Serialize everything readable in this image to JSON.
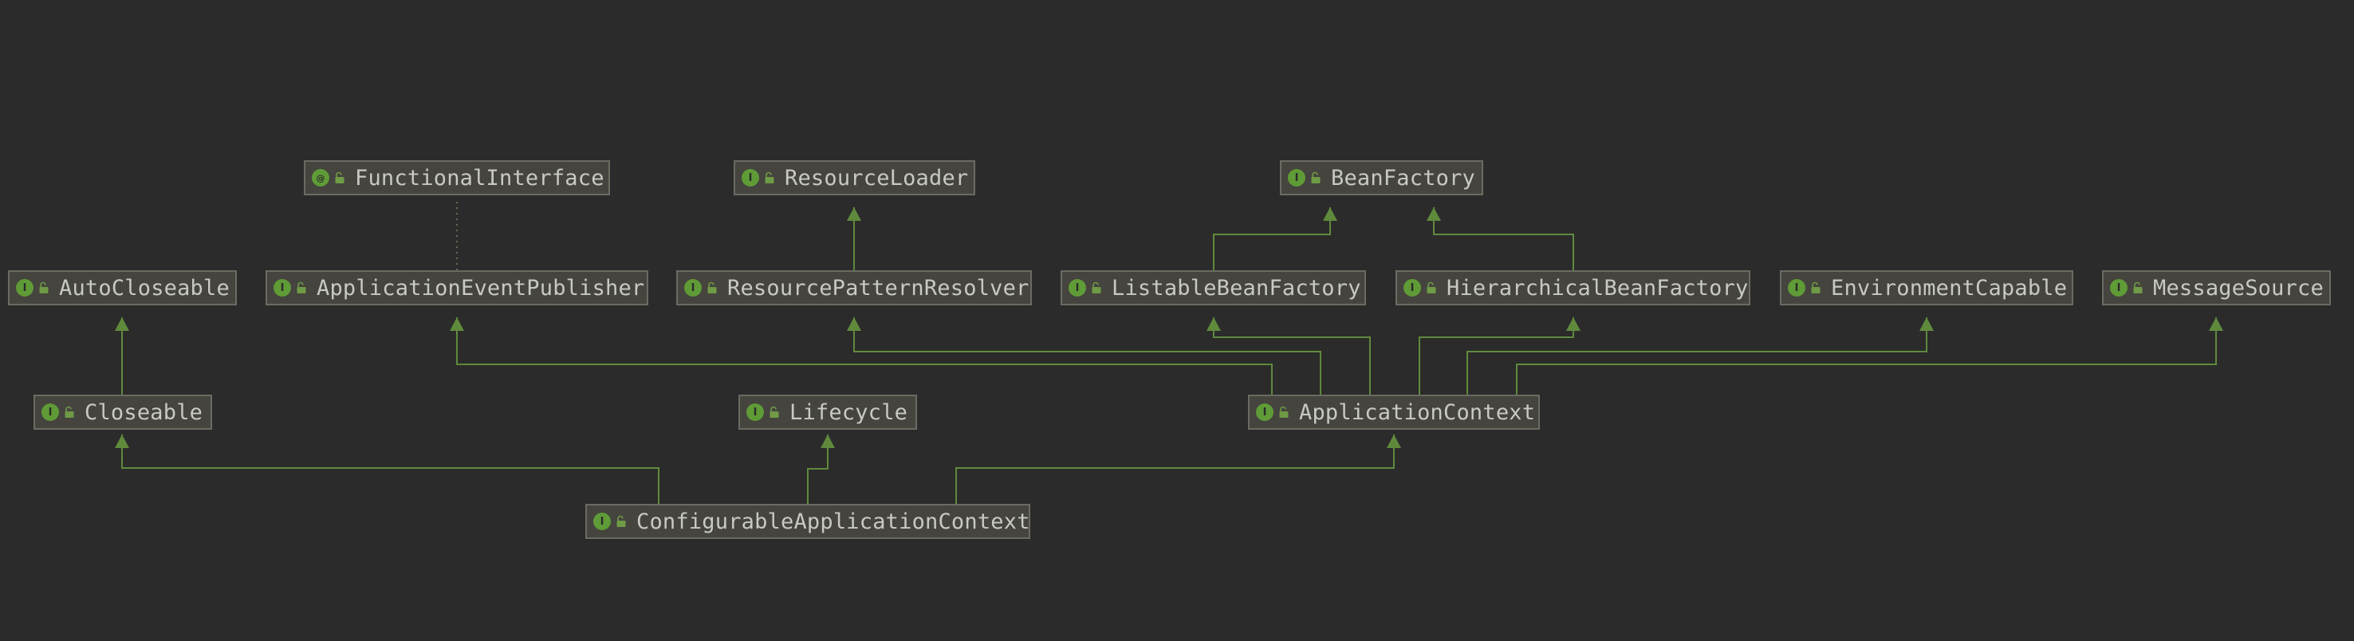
{
  "colors": {
    "background": "#2b2b2b",
    "node_fill": "#45443e",
    "node_border": "#6b6b62",
    "edge": "#5f8a3c",
    "badge": "#5f9b36",
    "text": "#c9c9c4"
  },
  "nodes": [
    {
      "id": "FunctionalInterface",
      "label": "FunctionalInterface",
      "kind": "annotation",
      "badge": "@",
      "visibility_icon": "unlocked-icon"
    },
    {
      "id": "ResourceLoader",
      "label": "ResourceLoader",
      "kind": "interface",
      "badge": "I",
      "visibility_icon": "unlocked-icon"
    },
    {
      "id": "BeanFactory",
      "label": "BeanFactory",
      "kind": "interface",
      "badge": "I",
      "visibility_icon": "unlocked-icon"
    },
    {
      "id": "AutoCloseable",
      "label": "AutoCloseable",
      "kind": "interface",
      "badge": "I",
      "visibility_icon": "unlocked-icon"
    },
    {
      "id": "ApplicationEventPublisher",
      "label": "ApplicationEventPublisher",
      "kind": "interface",
      "badge": "I",
      "visibility_icon": "unlocked-icon"
    },
    {
      "id": "ResourcePatternResolver",
      "label": "ResourcePatternResolver",
      "kind": "interface",
      "badge": "I",
      "visibility_icon": "unlocked-icon"
    },
    {
      "id": "ListableBeanFactory",
      "label": "ListableBeanFactory",
      "kind": "interface",
      "badge": "I",
      "visibility_icon": "unlocked-icon"
    },
    {
      "id": "HierarchicalBeanFactory",
      "label": "HierarchicalBeanFactory",
      "kind": "interface",
      "badge": "I",
      "visibility_icon": "unlocked-icon"
    },
    {
      "id": "EnvironmentCapable",
      "label": "EnvironmentCapable",
      "kind": "interface",
      "badge": "I",
      "visibility_icon": "unlocked-icon"
    },
    {
      "id": "MessageSource",
      "label": "MessageSource",
      "kind": "interface",
      "badge": "I",
      "visibility_icon": "unlocked-icon"
    },
    {
      "id": "Closeable",
      "label": "Closeable",
      "kind": "interface",
      "badge": "I",
      "visibility_icon": "unlocked-icon"
    },
    {
      "id": "Lifecycle",
      "label": "Lifecycle",
      "kind": "interface",
      "badge": "I",
      "visibility_icon": "unlocked-icon"
    },
    {
      "id": "ApplicationContext",
      "label": "ApplicationContext",
      "kind": "interface",
      "badge": "I",
      "visibility_icon": "unlocked-icon"
    },
    {
      "id": "ConfigurableApplicationContext",
      "label": "ConfigurableApplicationContext",
      "kind": "interface",
      "badge": "I",
      "visibility_icon": "unlocked-icon"
    }
  ],
  "edges": [
    {
      "from": "Closeable",
      "to": "AutoCloseable",
      "type": "extends"
    },
    {
      "from": "ApplicationEventPublisher",
      "to": "FunctionalInterface",
      "type": "annotated-by"
    },
    {
      "from": "ResourcePatternResolver",
      "to": "ResourceLoader",
      "type": "extends"
    },
    {
      "from": "ListableBeanFactory",
      "to": "BeanFactory",
      "type": "extends"
    },
    {
      "from": "HierarchicalBeanFactory",
      "to": "BeanFactory",
      "type": "extends"
    },
    {
      "from": "ApplicationContext",
      "to": "ApplicationEventPublisher",
      "type": "extends"
    },
    {
      "from": "ApplicationContext",
      "to": "ResourcePatternResolver",
      "type": "extends"
    },
    {
      "from": "ApplicationContext",
      "to": "ListableBeanFactory",
      "type": "extends"
    },
    {
      "from": "ApplicationContext",
      "to": "HierarchicalBeanFactory",
      "type": "extends"
    },
    {
      "from": "ApplicationContext",
      "to": "EnvironmentCapable",
      "type": "extends"
    },
    {
      "from": "ApplicationContext",
      "to": "MessageSource",
      "type": "extends"
    },
    {
      "from": "ConfigurableApplicationContext",
      "to": "Closeable",
      "type": "extends"
    },
    {
      "from": "ConfigurableApplicationContext",
      "to": "Lifecycle",
      "type": "extends"
    },
    {
      "from": "ConfigurableApplicationContext",
      "to": "ApplicationContext",
      "type": "extends"
    }
  ]
}
